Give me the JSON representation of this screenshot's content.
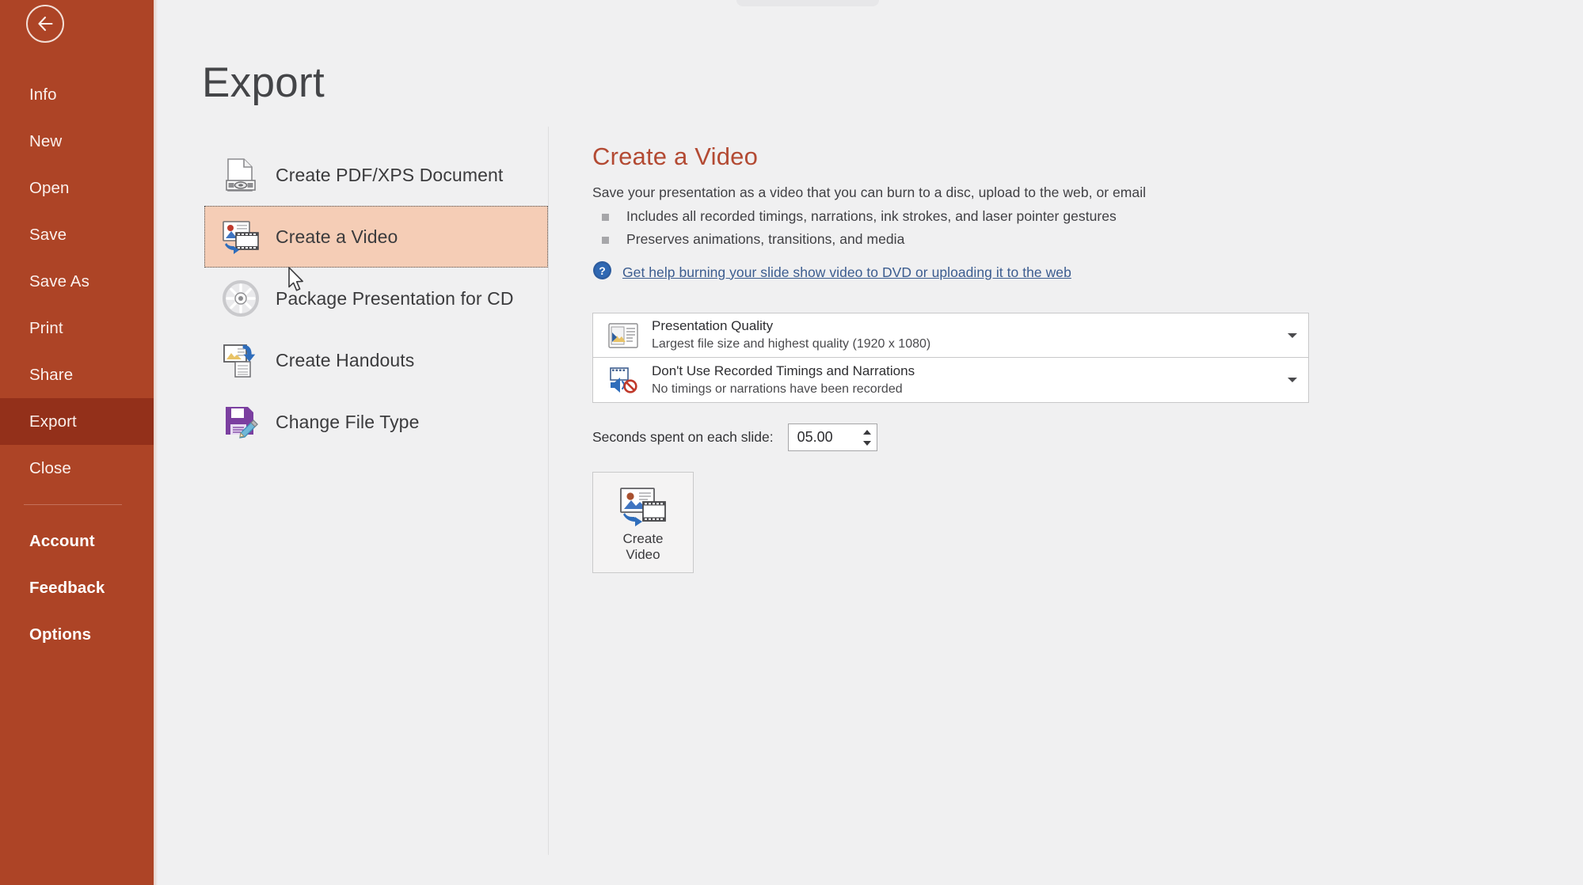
{
  "window": {
    "back_button": "back-arrow"
  },
  "sidebar": {
    "items": [
      {
        "label": "Info",
        "state": "normal"
      },
      {
        "label": "New",
        "state": "normal"
      },
      {
        "label": "Open",
        "state": "normal"
      },
      {
        "label": "Save",
        "state": "normal"
      },
      {
        "label": "Save As",
        "state": "normal"
      },
      {
        "label": "Print",
        "state": "normal"
      },
      {
        "label": "Share",
        "state": "normal"
      },
      {
        "label": "Export",
        "state": "active"
      },
      {
        "label": "Close",
        "state": "normal"
      }
    ],
    "footer_items": [
      {
        "label": "Account"
      },
      {
        "label": "Feedback"
      },
      {
        "label": "Options"
      }
    ],
    "colors": {
      "background": "#ad4426",
      "active_background": "#93301a",
      "text": "#fbf0ec"
    }
  },
  "page": {
    "title": "Export"
  },
  "export_options": [
    {
      "label": "Create PDF/XPS Document",
      "icon": "pdf-xps-document-icon",
      "selected": false
    },
    {
      "label": "Create a Video",
      "icon": "create-video-icon",
      "selected": true
    },
    {
      "label": "Package Presentation for CD",
      "icon": "cd-disc-icon",
      "selected": false
    },
    {
      "label": "Create Handouts",
      "icon": "create-handouts-icon",
      "selected": false
    },
    {
      "label": "Change File Type",
      "icon": "floppy-disk-pencil-icon",
      "selected": false
    }
  ],
  "detail": {
    "title": "Create a Video",
    "title_color": "#b34a33",
    "description": "Save your presentation as a video that you can burn to a disc, upload to the web, or email",
    "bullets": [
      "Includes all recorded timings, narrations, ink strokes, and laser pointer gestures",
      "Preserves animations, transitions, and media"
    ],
    "help_link": "Get help burning your slide show video to DVD or uploading it to the web",
    "help_link_color": "#3b5c8f",
    "quality_dropdown": {
      "icon": "presentation-quality-icon",
      "primary": "Presentation Quality",
      "secondary": "Largest file size and highest quality (1920 x 1080)"
    },
    "timings_dropdown": {
      "icon": "timings-narrations-disabled-icon",
      "primary": "Don't Use Recorded Timings and Narrations",
      "secondary": "No timings or narrations have been recorded"
    },
    "seconds_field": {
      "label": "Seconds spent on each slide:",
      "value": "05.00"
    },
    "create_video_button": {
      "icon": "create-video-icon",
      "line1": "Create",
      "line2": "Video"
    }
  }
}
